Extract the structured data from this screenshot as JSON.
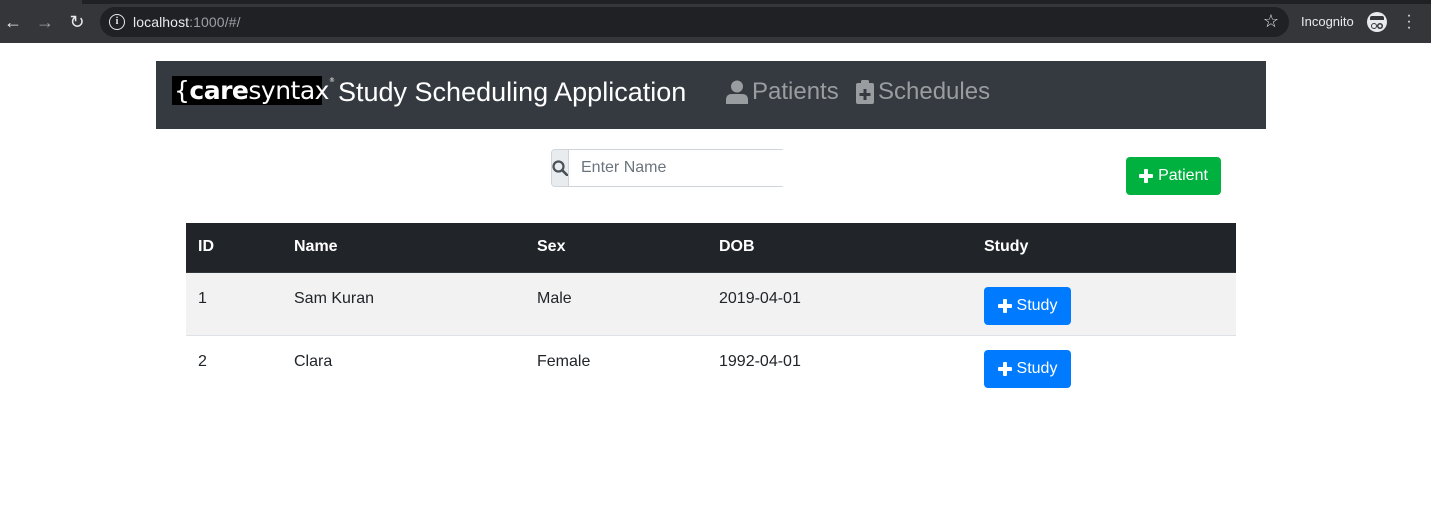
{
  "browser": {
    "url_host": "localhost",
    "url_rest": ":1000/#/",
    "incognito_label": "Incognito"
  },
  "navbar": {
    "logo_care": "care",
    "logo_syntax": "syntax",
    "logo_reg": "®",
    "title": "Study Scheduling Application",
    "links": [
      {
        "label": "Patients",
        "icon": "user-icon"
      },
      {
        "label": "Schedules",
        "icon": "clipboard-plus-icon"
      }
    ]
  },
  "search": {
    "placeholder": "Enter Name",
    "value": ""
  },
  "add_patient_label": "Patient",
  "table": {
    "headers": [
      "ID",
      "Name",
      "Sex",
      "DOB",
      "Study"
    ],
    "rows": [
      {
        "id": "1",
        "name": "Sam Kuran",
        "sex": "Male",
        "dob": "2019-04-01",
        "study_label": "Study"
      },
      {
        "id": "2",
        "name": "Clara",
        "sex": "Female",
        "dob": "1992-04-01",
        "study_label": "Study"
      }
    ]
  },
  "colors": {
    "navbar_bg": "#343a40",
    "success": "#00b140",
    "primary": "#007bff",
    "table_head_bg": "#212529"
  }
}
